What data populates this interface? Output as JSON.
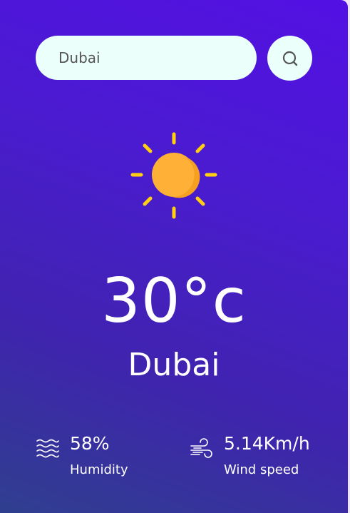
{
  "search": {
    "value": "Dubai",
    "button_icon": "search-icon"
  },
  "weather": {
    "icon": "sun-icon",
    "temperature": "30°c",
    "city": "Dubai"
  },
  "humidity": {
    "icon": "humidity-waves-icon",
    "value": "58%",
    "label": "Humidity"
  },
  "wind": {
    "icon": "wind-icon",
    "value": "5.14Km/h",
    "label": "Wind speed"
  },
  "colors": {
    "gradient_top": "#5310e3",
    "gradient_bottom": "#2f3f8e",
    "search_bg": "#ebfffb",
    "sun": "#ffb037",
    "sun_rays": "#ffcf10"
  }
}
